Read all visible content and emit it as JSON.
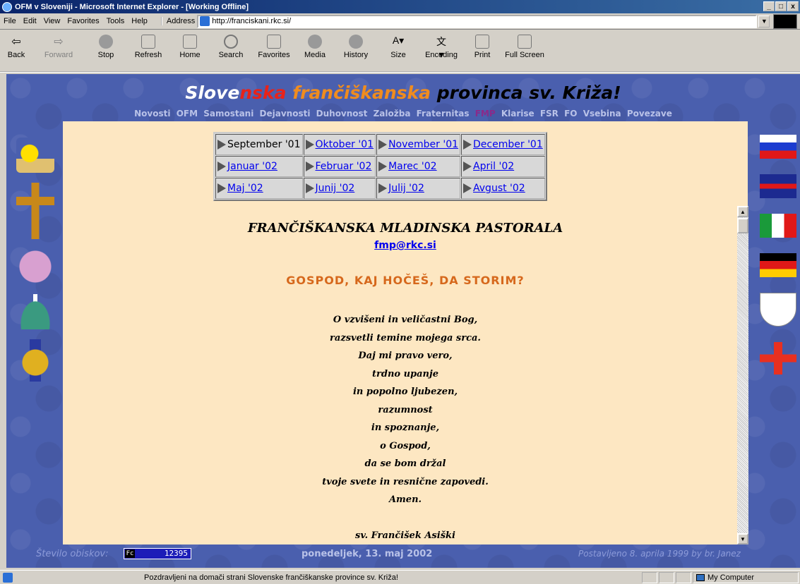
{
  "window": {
    "title": "OFM v Sloveniji - Microsoft Internet Explorer - [Working Offline]",
    "controls": [
      "_",
      "□",
      "x"
    ]
  },
  "menu": [
    "File",
    "Edit",
    "View",
    "Favorites",
    "Tools",
    "Help"
  ],
  "address": {
    "label": "Address",
    "url": "http://franciskani.rkc.si/"
  },
  "toolbar": [
    {
      "label": "Back",
      "icon": "back-arrow-icon",
      "enabled": true
    },
    {
      "label": "Forward",
      "icon": "forward-arrow-icon",
      "enabled": false
    },
    {
      "label": "Stop",
      "icon": "stop-icon",
      "enabled": true
    },
    {
      "label": "Refresh",
      "icon": "refresh-icon",
      "enabled": true
    },
    {
      "label": "Home",
      "icon": "home-icon",
      "enabled": true
    },
    {
      "label": "Search",
      "icon": "search-icon",
      "enabled": true
    },
    {
      "label": "Favorites",
      "icon": "favorites-icon",
      "enabled": true
    },
    {
      "label": "Media",
      "icon": "media-icon",
      "enabled": true
    },
    {
      "label": "History",
      "icon": "history-icon",
      "enabled": true
    },
    {
      "label": "Size",
      "icon": "text-size-icon",
      "enabled": true
    },
    {
      "label": "Encoding",
      "icon": "encoding-icon",
      "enabled": true
    },
    {
      "label": "Print",
      "icon": "print-icon",
      "enabled": true
    },
    {
      "label": "Full Screen",
      "icon": "fullscreen-icon",
      "enabled": true
    }
  ],
  "site": {
    "title_parts": [
      "Slove",
      "nska",
      " frančiškanska",
      " provinca sv. Križa!"
    ],
    "nav": [
      "Novosti",
      "OFM",
      "Samostani",
      "Dejavnosti",
      "Duhovnost",
      "Založba",
      "Fraternitas",
      "FMP",
      "Klarise",
      "FSR",
      "FO",
      "Vsebina",
      "Povezave"
    ],
    "months": [
      [
        "September '01",
        "Oktober '01",
        "November '01",
        "December '01"
      ],
      [
        "Januar '02",
        "Februar '02",
        "Marec '02",
        "April '02"
      ],
      [
        "Maj '02",
        "Junij '02",
        "Julij '02",
        "Avgust '02"
      ]
    ],
    "heading": "FRANČIŠKANSKA MLADINSKA PASTORALA",
    "email": "fmp@rkc.si",
    "prayer_title": "GOSPOD, KAJ HOČEŠ, DA STORIM?",
    "prayer_lines": [
      "O vzvišeni in veličastni Bog,",
      "razsvetli temine mojega srca.",
      "Daj mi pravo vero,",
      "trdno upanje",
      "in popolno ljubezen,",
      "razumnost",
      "in spoznanje,",
      "o Gospod,",
      "da se bom držal",
      "tvoje svete in resnične zapovedi.",
      "Amen.",
      "",
      "sv. Frančišek Asiški"
    ],
    "visits_label": "Število obiskov:",
    "counter_prefix": "Fc",
    "counter_value": "12395",
    "date": "ponedeljek, 13. maj 2002",
    "posted_text": "Postavljeno 8. aprila 1999 by ",
    "posted_author": "br. Janez"
  },
  "status": {
    "text": "Pozdravljeni na domači strani Slovenske frančiškanske province sv. Križa!",
    "zone": "My Computer"
  }
}
